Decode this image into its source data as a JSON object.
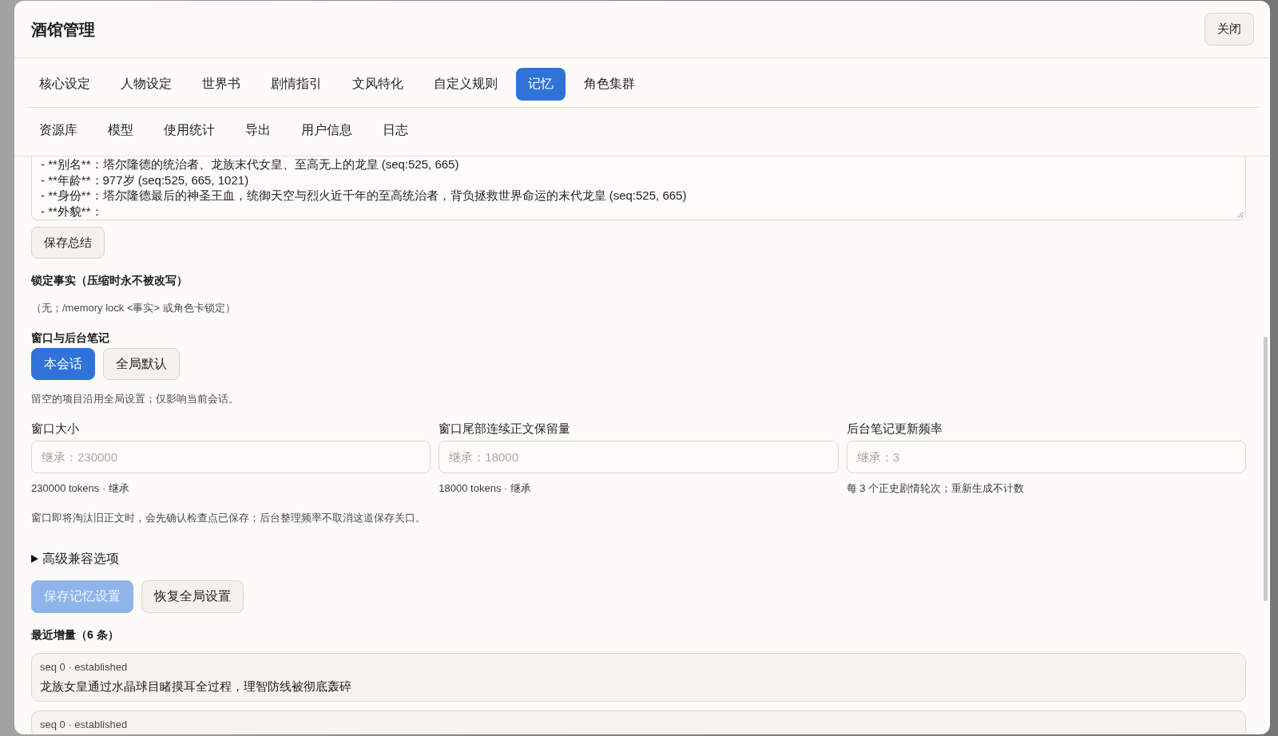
{
  "window": {
    "title": "酒馆管理",
    "close_button": "关闭"
  },
  "tabs": [
    {
      "label": "核心设定",
      "selected": false
    },
    {
      "label": "人物设定",
      "selected": false
    },
    {
      "label": "世界书",
      "selected": false
    },
    {
      "label": "剧情指引",
      "selected": false
    },
    {
      "label": "文风特化",
      "selected": false
    },
    {
      "label": "自定义规则",
      "selected": false
    },
    {
      "label": "记忆",
      "selected": true
    },
    {
      "label": "角色集群",
      "selected": false
    }
  ],
  "secondary_tabs": [
    {
      "label": "资源库",
      "selected": false
    },
    {
      "label": "模型",
      "selected": false
    },
    {
      "label": "使用统计",
      "selected": false
    },
    {
      "label": "导出",
      "selected": false
    },
    {
      "label": "用户信息",
      "selected": false
    },
    {
      "label": "日志",
      "selected": false
    }
  ],
  "summary": {
    "lines": [
      "- **别名**：塔尔隆德的统治者、龙族末代女皇、至高无上的龙皇 (seq:525, 665)",
      "- **年龄**：977岁 (seq:525, 665, 1021)",
      "- **身份**：塔尔隆德最后的神圣王血，统御天空与烈火近千年的至高统治者，背负拯救世界命运的末代龙皇 (seq:525, 665)",
      "- **外貌**："
    ],
    "save_button": "保存总结"
  },
  "locked_facts": {
    "heading": "锁定事实（压缩时永不被改写）",
    "empty_text": "（无；/memory lock <事实> 或角色卡锁定）"
  },
  "window_notes": {
    "heading": "窗口与后台笔记",
    "scope_options": [
      {
        "label": "本会话",
        "selected": true
      },
      {
        "label": "全局默认",
        "selected": false
      }
    ],
    "help": "留空的项目沿用全局设置；仅影响当前会话。",
    "fields": [
      {
        "label": "窗口大小",
        "placeholder": "继承：230000",
        "hint": "230000 tokens · 继承"
      },
      {
        "label": "窗口尾部连续正文保留量",
        "placeholder": "继承：18000",
        "hint": "18000 tokens · 继承"
      },
      {
        "label": "后台笔记更新频率",
        "placeholder": "继承：3",
        "hint": "每 3 个正史剧情轮次；重新生成不计数"
      }
    ],
    "note": "窗口即将淘汰旧正文时，会先确认检查点已保存；后台整理频率不取消这道保存关口。"
  },
  "advanced": {
    "label": "高级兼容选项",
    "expanded": false
  },
  "actions": [
    {
      "label": "保存记忆设置",
      "kind": "primary",
      "disabled": true
    },
    {
      "label": "恢复全局设置",
      "kind": "secondary",
      "disabled": false
    }
  ],
  "recent": {
    "heading": "最近增量（6 条）",
    "items": [
      {
        "meta": "seq 0 · established",
        "text": "龙族女皇通过水晶球目睹摸耳全过程，理智防线被彻底轰碎"
      },
      {
        "meta": "seq 0 · established"
      }
    ]
  }
}
